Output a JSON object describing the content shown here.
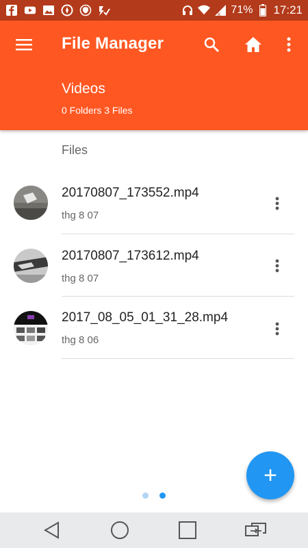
{
  "status_bar": {
    "battery": "71%",
    "time": "17:21",
    "icons": [
      "facebook-icon",
      "youtube-icon",
      "gallery-icon",
      "compass-icon",
      "shield-icon",
      "checkmark-app-icon",
      "headphones-icon",
      "wifi-icon",
      "signal-icon",
      "battery-icon"
    ]
  },
  "app_bar": {
    "title": "File Manager",
    "folder_name": "Videos",
    "folder_summary": "0 Folders 3 Files",
    "color": "#ff5722"
  },
  "section": {
    "label": "Files"
  },
  "files": [
    {
      "name": "20170807_173552.mp4",
      "date": "thg 8 07"
    },
    {
      "name": "20170807_173612.mp4",
      "date": "thg 8 07"
    },
    {
      "name": "2017_08_05_01_31_28.mp4",
      "date": "thg 8 06"
    }
  ],
  "pager": {
    "pages": 2,
    "current": 2
  },
  "fab": {
    "label": "+",
    "color": "#2196f3"
  }
}
